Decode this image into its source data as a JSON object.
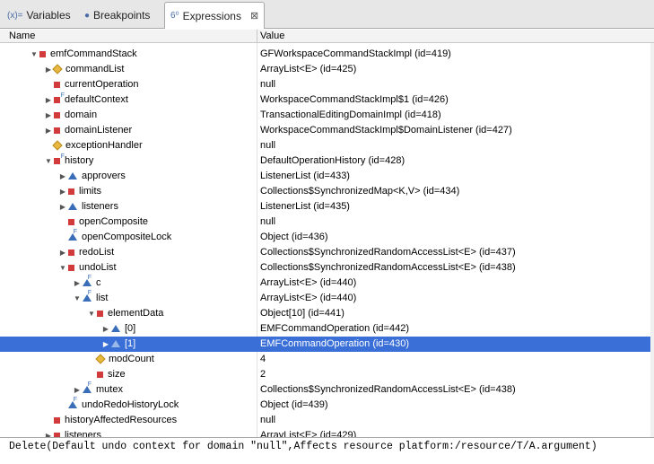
{
  "tabs": [
    {
      "label": "Variables",
      "icon": "variables-icon",
      "glyph": "(x)="
    },
    {
      "label": "Breakpoints",
      "icon": "breakpoints-icon",
      "glyph": "●"
    },
    {
      "label": "Expressions",
      "icon": "expressions-icon",
      "glyph": "6⁰"
    }
  ],
  "columns": {
    "name": "Name",
    "value": "Value"
  },
  "rows": [
    {
      "name": "emfCommandStack",
      "value": "GFWorkspaceCommandStackImpl  (id=419)"
    },
    {
      "name": "commandList",
      "value": "ArrayList<E>  (id=425)"
    },
    {
      "name": "currentOperation",
      "value": "null"
    },
    {
      "name": "defaultContext",
      "value": "WorkspaceCommandStackImpl$1  (id=426)"
    },
    {
      "name": "domain",
      "value": "TransactionalEditingDomainImpl  (id=418)"
    },
    {
      "name": "domainListener",
      "value": "WorkspaceCommandStackImpl$DomainListener  (id=427)"
    },
    {
      "name": "exceptionHandler",
      "value": "null"
    },
    {
      "name": "history",
      "value": "DefaultOperationHistory  (id=428)"
    },
    {
      "name": "approvers",
      "value": "ListenerList  (id=433)"
    },
    {
      "name": "limits",
      "value": "Collections$SynchronizedMap<K,V>  (id=434)"
    },
    {
      "name": "listeners",
      "value": "ListenerList  (id=435)"
    },
    {
      "name": "openComposite",
      "value": "null"
    },
    {
      "name": "openCompositeLock",
      "value": "Object  (id=436)"
    },
    {
      "name": "redoList",
      "value": "Collections$SynchronizedRandomAccessList<E>  (id=437)"
    },
    {
      "name": "undoList",
      "value": "Collections$SynchronizedRandomAccessList<E>  (id=438)"
    },
    {
      "name": "c",
      "value": "ArrayList<E>  (id=440)"
    },
    {
      "name": "list",
      "value": "ArrayList<E>  (id=440)"
    },
    {
      "name": "elementData",
      "value": "Object[10]  (id=441)"
    },
    {
      "name": "[0]",
      "value": "EMFCommandOperation  (id=442)"
    },
    {
      "name": "[1]",
      "value": "EMFCommandOperation  (id=430)"
    },
    {
      "name": "modCount",
      "value": "4"
    },
    {
      "name": "size",
      "value": "2"
    },
    {
      "name": "mutex",
      "value": "Collections$SynchronizedRandomAccessList<E>  (id=438)"
    },
    {
      "name": "undoRedoHistoryLock",
      "value": "Object  (id=439)"
    },
    {
      "name": "historyAffectedResources",
      "value": "null"
    },
    {
      "name": "listeners",
      "value": "ArrayList<E>  (id=429)"
    }
  ],
  "detail_text": "Delete(Default undo context for domain \"null\",Affects resource platform:/resource/T/A.argument)"
}
